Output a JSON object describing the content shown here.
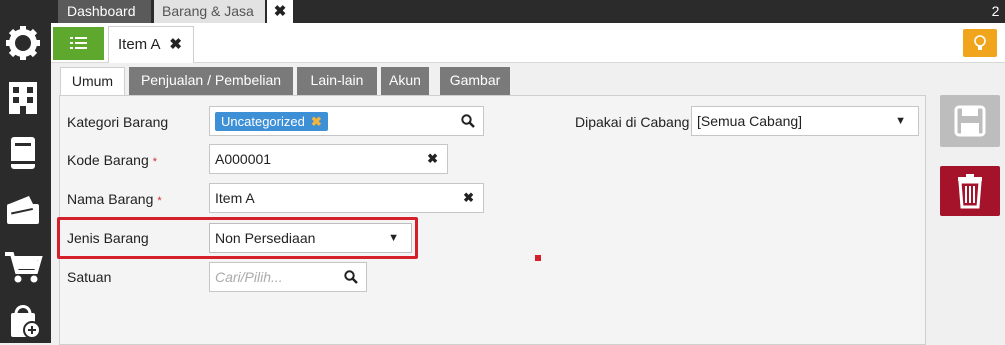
{
  "sidebar": {
    "icons": [
      "settings-gear-icon",
      "building-icon",
      "book-icon",
      "wallet-icon",
      "cart-icon",
      "bag-add-icon"
    ]
  },
  "topbar": {
    "tabs": [
      {
        "label": "Dashboard"
      },
      {
        "label": "Barang & Jasa"
      }
    ],
    "close_label": "✖",
    "counter": "2"
  },
  "subbar": {
    "item_tab_label": "Item A",
    "item_tab_close": "✖"
  },
  "form_tabs": [
    "Umum",
    "Penjualan / Pembelian",
    "Lain-lain",
    "Akun",
    "Gambar"
  ],
  "form": {
    "kategori_label": "Kategori Barang",
    "kategori_tag": "Uncategorized",
    "kategori_tag_close": "✖",
    "kode_label": "Kode Barang",
    "kode_value": "A000001",
    "nama_label": "Nama Barang",
    "nama_value": "Item A",
    "jenis_label": "Jenis Barang",
    "jenis_value": "Non Persediaan",
    "satuan_label": "Satuan",
    "satuan_placeholder": "Cari/Pilih...",
    "cabang_label": "Dipakai di Cabang",
    "cabang_value": "[Semua Cabang]",
    "required_mark": "*",
    "clear_mark": "✖",
    "dropdown_caret": "▼"
  },
  "colors": {
    "accent_green": "#5fa82e",
    "tag_blue": "#3d8fd6",
    "highlight_red": "#d3202a",
    "delete_red": "#a5132b",
    "bulb_orange": "#f0a51c"
  }
}
